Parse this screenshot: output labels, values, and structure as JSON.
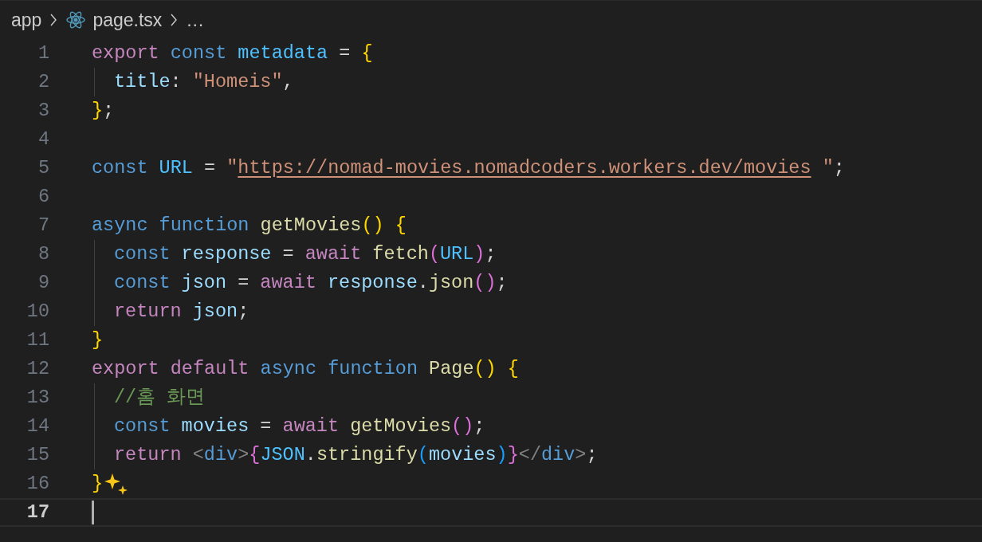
{
  "breadcrumb": [
    {
      "label": "app",
      "kind": "folder"
    },
    {
      "label": "page.tsx",
      "kind": "file"
    },
    {
      "label": "…",
      "kind": "more"
    }
  ],
  "lines": [
    {
      "number": "1",
      "indented": false,
      "current": false,
      "sparkle": false,
      "tokens": [
        {
          "text": "export",
          "kind": "keyword"
        },
        {
          "text": " const",
          "kind": "storage"
        },
        {
          "text": " metadata",
          "kind": "constant"
        },
        {
          "text": " = ",
          "kind": "punct"
        },
        {
          "text": "{",
          "kind": "bracket1"
        }
      ]
    },
    {
      "number": "2",
      "indented": true,
      "current": false,
      "sparkle": false,
      "tokens": [
        {
          "text": "title",
          "kind": "variable"
        },
        {
          "text": ": ",
          "kind": "punct"
        },
        {
          "text": "\"Homeis\"",
          "kind": "string"
        },
        {
          "text": ",",
          "kind": "punct"
        }
      ]
    },
    {
      "number": "3",
      "indented": false,
      "current": false,
      "sparkle": false,
      "tokens": [
        {
          "text": "}",
          "kind": "bracket1"
        },
        {
          "text": ";",
          "kind": "punct"
        }
      ]
    },
    {
      "number": "4",
      "indented": false,
      "current": false,
      "sparkle": false
    },
    {
      "number": "5",
      "indented": false,
      "current": false,
      "sparkle": false,
      "tokens": [
        {
          "text": "const",
          "kind": "storage"
        },
        {
          "text": " URL",
          "kind": "constant"
        },
        {
          "text": " = ",
          "kind": "punct"
        },
        {
          "text": "\"",
          "kind": "string"
        },
        {
          "text": "https://nomad-movies.nomadcoders.workers.dev/movies",
          "kind": "link"
        },
        {
          "text": " \"",
          "kind": "string"
        },
        {
          "text": ";",
          "kind": "punct"
        }
      ]
    },
    {
      "number": "6",
      "indented": false,
      "current": false,
      "sparkle": false
    },
    {
      "number": "7",
      "indented": false,
      "current": false,
      "sparkle": false,
      "tokens": [
        {
          "text": "async",
          "kind": "storage"
        },
        {
          "text": " function",
          "kind": "storage"
        },
        {
          "text": " getMovies",
          "kind": "function"
        },
        {
          "text": "()",
          "kind": "bracket1"
        },
        {
          "text": " {",
          "kind": "bracket1"
        }
      ]
    },
    {
      "number": "8",
      "indented": true,
      "current": false,
      "sparkle": false,
      "tokens": [
        {
          "text": "const",
          "kind": "storage"
        },
        {
          "text": " response",
          "kind": "variable"
        },
        {
          "text": " = ",
          "kind": "punct"
        },
        {
          "text": "await",
          "kind": "keyword"
        },
        {
          "text": " fetch",
          "kind": "function"
        },
        {
          "text": "(",
          "kind": "bracket2"
        },
        {
          "text": "URL",
          "kind": "constant"
        },
        {
          "text": ")",
          "kind": "bracket2"
        },
        {
          "text": ";",
          "kind": "punct"
        }
      ]
    },
    {
      "number": "9",
      "indented": true,
      "current": false,
      "sparkle": false,
      "tokens": [
        {
          "text": "const",
          "kind": "storage"
        },
        {
          "text": " json",
          "kind": "variable"
        },
        {
          "text": " = ",
          "kind": "punct"
        },
        {
          "text": "await",
          "kind": "keyword"
        },
        {
          "text": " response",
          "kind": "variable"
        },
        {
          "text": ".",
          "kind": "punct"
        },
        {
          "text": "json",
          "kind": "function"
        },
        {
          "text": "()",
          "kind": "bracket2"
        },
        {
          "text": ";",
          "kind": "punct"
        }
      ]
    },
    {
      "number": "10",
      "indented": true,
      "current": false,
      "sparkle": false,
      "tokens": [
        {
          "text": "return",
          "kind": "keyword"
        },
        {
          "text": " json",
          "kind": "variable"
        },
        {
          "text": ";",
          "kind": "punct"
        }
      ]
    },
    {
      "number": "11",
      "indented": false,
      "current": false,
      "sparkle": false,
      "tokens": [
        {
          "text": "}",
          "kind": "bracket1"
        }
      ]
    },
    {
      "number": "12",
      "indented": false,
      "current": false,
      "sparkle": false,
      "tokens": [
        {
          "text": "export",
          "kind": "keyword"
        },
        {
          "text": " default",
          "kind": "keyword"
        },
        {
          "text": " async",
          "kind": "storage"
        },
        {
          "text": " function",
          "kind": "storage"
        },
        {
          "text": " Page",
          "kind": "function"
        },
        {
          "text": "()",
          "kind": "bracket1"
        },
        {
          "text": " {",
          "kind": "bracket1"
        }
      ]
    },
    {
      "number": "13",
      "indented": true,
      "current": false,
      "sparkle": false,
      "tokens": [
        {
          "text": "//홈 화면",
          "kind": "comment"
        }
      ]
    },
    {
      "number": "14",
      "indented": true,
      "current": false,
      "sparkle": false,
      "tokens": [
        {
          "text": "const",
          "kind": "storage"
        },
        {
          "text": " movies",
          "kind": "variable"
        },
        {
          "text": " = ",
          "kind": "punct"
        },
        {
          "text": "await",
          "kind": "keyword"
        },
        {
          "text": " getMovies",
          "kind": "function"
        },
        {
          "text": "()",
          "kind": "bracket2"
        },
        {
          "text": ";",
          "kind": "punct"
        }
      ]
    },
    {
      "number": "15",
      "indented": true,
      "current": false,
      "sparkle": false,
      "tokens": [
        {
          "text": "return",
          "kind": "keyword"
        },
        {
          "text": " <",
          "kind": "tag"
        },
        {
          "text": "div",
          "kind": "storage"
        },
        {
          "text": ">",
          "kind": "tag"
        },
        {
          "text": "{",
          "kind": "bracket2"
        },
        {
          "text": "JSON",
          "kind": "constant"
        },
        {
          "text": ".",
          "kind": "punct"
        },
        {
          "text": "stringify",
          "kind": "function"
        },
        {
          "text": "(",
          "kind": "bracket3"
        },
        {
          "text": "movies",
          "kind": "variable"
        },
        {
          "text": ")",
          "kind": "bracket3"
        },
        {
          "text": "}",
          "kind": "bracket2"
        },
        {
          "text": "</",
          "kind": "tag"
        },
        {
          "text": "div",
          "kind": "storage"
        },
        {
          "text": ">",
          "kind": "tag"
        },
        {
          "text": ";",
          "kind": "punct"
        }
      ]
    },
    {
      "number": "16",
      "indented": false,
      "current": false,
      "sparkle": true,
      "tokens": [
        {
          "text": "}",
          "kind": "bracket1"
        }
      ]
    },
    {
      "number": "17",
      "indented": false,
      "current": true,
      "sparkle": false
    }
  ]
}
